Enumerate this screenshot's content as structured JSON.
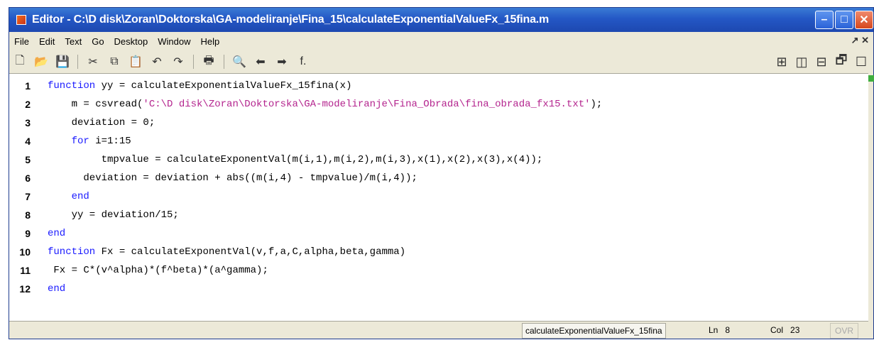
{
  "window": {
    "title": "Editor - C:\\D disk\\Zoran\\Doktorska\\GA-modeliranje\\Fina_15\\calculateExponentialValueFx_15fina.m",
    "buttons": {
      "minimize": "–",
      "maximize": "□",
      "close": "✕"
    }
  },
  "menu": [
    "File",
    "Edit",
    "Text",
    "Go",
    "Desktop",
    "Window",
    "Help"
  ],
  "menu_right": "↗ ✕",
  "toolbar": {
    "icons": [
      "new-file-icon",
      "open-file-icon",
      "save-icon",
      "cut-icon",
      "copy-icon",
      "paste-icon",
      "undo-icon",
      "redo-icon",
      "print-icon",
      "find-icon",
      "back-icon",
      "forward-icon",
      "function-icon"
    ],
    "glyphs": {
      "new": "🗋",
      "open": "📂",
      "save": "💾",
      "cut": "✂",
      "copy": "⧉",
      "paste": "📋",
      "undo": "↶",
      "redo": "↷",
      "print": "🖶",
      "find": "🔍",
      "back": "⬅",
      "forward": "➡",
      "function": "f."
    },
    "layout_glyphs": {
      "tile": "⊞",
      "cols": "◫",
      "rows": "⊟",
      "float": "🗗",
      "maximize": "☐"
    }
  },
  "code_lines": [
    {
      "n": "1",
      "parts": [
        {
          "t": "function",
          "k": "kw"
        },
        {
          "t": " yy = calculateExponentialValueFx_15fina(x)",
          "k": ""
        }
      ]
    },
    {
      "n": "2",
      "parts": [
        {
          "t": "    m = csvread(",
          "k": ""
        },
        {
          "t": "'C:\\D disk\\Zoran\\Doktorska\\GA-modeliranje\\Fina_Obrada\\fina_obrada_fx15.txt'",
          "k": "str"
        },
        {
          "t": ");",
          "k": ""
        }
      ]
    },
    {
      "n": "3",
      "parts": [
        {
          "t": "    deviation = 0;",
          "k": ""
        }
      ]
    },
    {
      "n": "4",
      "parts": [
        {
          "t": "    ",
          "k": ""
        },
        {
          "t": "for",
          "k": "kw"
        },
        {
          "t": " i=1:15",
          "k": ""
        }
      ]
    },
    {
      "n": "5",
      "parts": [
        {
          "t": "         tmpvalue = calculateExponentVal(m(i,1),m(i,2),m(i,3),x(1),x(2),x(3),x(4));",
          "k": ""
        }
      ]
    },
    {
      "n": "6",
      "parts": [
        {
          "t": "      deviation = deviation + abs((m(i,4) - tmpvalue)/m(i,4));",
          "k": ""
        }
      ]
    },
    {
      "n": "7",
      "parts": [
        {
          "t": "    ",
          "k": ""
        },
        {
          "t": "end",
          "k": "kw"
        }
      ]
    },
    {
      "n": "8",
      "parts": [
        {
          "t": "    yy = deviation/15;",
          "k": ""
        }
      ]
    },
    {
      "n": "9",
      "parts": [
        {
          "t": "end",
          "k": "kw"
        }
      ]
    },
    {
      "n": "10",
      "parts": [
        {
          "t": "function",
          "k": "kw"
        },
        {
          "t": " Fx = calculateExponentVal(v,f,a,C,alpha,beta,gamma)",
          "k": ""
        }
      ]
    },
    {
      "n": "11",
      "parts": [
        {
          "t": " Fx = C*(v^alpha)*(f^beta)*(a^gamma);",
          "k": ""
        }
      ]
    },
    {
      "n": "12",
      "parts": [
        {
          "t": "end",
          "k": "kw"
        }
      ]
    }
  ],
  "status": {
    "file": "calculateExponentialValueFx_15fina",
    "ln_label": "Ln",
    "ln_value": "8",
    "col_label": "Col",
    "col_value": "23",
    "ovr": "OVR"
  }
}
